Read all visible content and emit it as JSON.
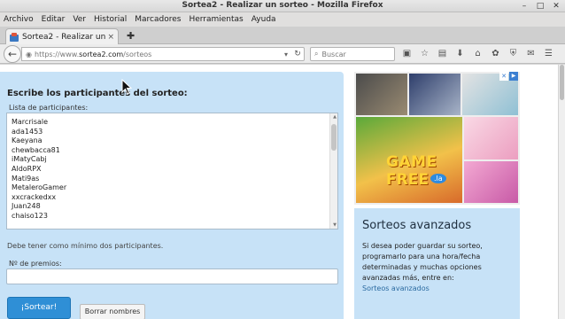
{
  "window": {
    "title": "Sortea2 - Realizar un sorteo - Mozilla Firefox"
  },
  "menubar": {
    "items": [
      "Archivo",
      "Editar",
      "Ver",
      "Historial",
      "Marcadores",
      "Herramientas",
      "Ayuda"
    ]
  },
  "tab": {
    "label": "Sortea2 - Realizar un ...",
    "close": "×"
  },
  "newtab": {
    "label": "✚"
  },
  "urlbar": {
    "prefix": "https://www.",
    "domain": "sortea2.com",
    "path": "/sorteos"
  },
  "searchbar": {
    "placeholder": "Buscar"
  },
  "form": {
    "heading": "Escribe los participantes del sorteo:",
    "list_label": "Lista de participantes:",
    "participants": [
      "Marcrisale",
      "ada1453",
      "Kaeyana",
      "chewbacca81",
      "iMatyCabj",
      "AldoRPX",
      "Mati9as",
      "MetaleroGamer",
      "xxcrackedxx",
      "Juan248",
      "chaiso123"
    ],
    "hint": "Debe tener como mínimo dos participantes.",
    "prizes_label": "Nº de premios:",
    "prizes_value": "",
    "sortear_button": "¡Sortear!",
    "borrar_button": "Borrar nombres"
  },
  "ad": {
    "game_word": "GAME",
    "free_word": "FREE",
    "suffix": ".la"
  },
  "advanced": {
    "title": "Sorteos avanzados",
    "text": "Si desea poder guardar su sorteo, programarlo para una hora/fecha determinadas y muchas opciones avanzadas más, entre en:",
    "link": "Sorteos avanzados"
  },
  "colors": {
    "panel": "#c7e2f7",
    "primary_button": "#2f8fd6",
    "link": "#2a6aa0"
  }
}
